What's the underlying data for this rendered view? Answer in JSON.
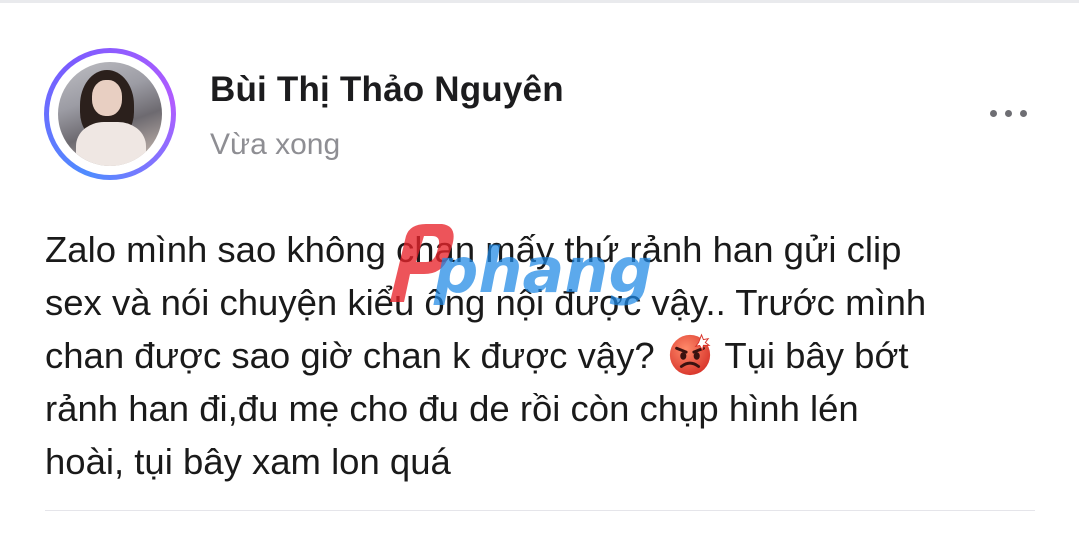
{
  "post": {
    "author_name": "Bùi Thị Thảo Nguyên",
    "timestamp": "Vừa xong",
    "text_lines": [
      "Zalo mình sao không chan mấy thứ rảnh han gửi clip",
      "sex và nói chuyện kiểu ông nội được vậy.. Trước mình",
      "chan được sao giờ chan k được vậy?",
      "Tụi bây bớt",
      "rảnh han đi,đu mẹ cho đu de rồi còn chụp hình lén",
      "hoài, tụi bây xam lon quá"
    ],
    "emoji": "angry-face",
    "more_icon": "more-horizontal-icon"
  },
  "watermark": {
    "text": "phang",
    "icon": "watermark-logo"
  },
  "colors": {
    "avatar_ring_start": "#4f8cff",
    "avatar_ring_end": "#b15cff",
    "name_text": "#1c1c1e",
    "timestamp_text": "#8e8e93",
    "body_text": "#1a1a1a",
    "emoji_fill": "#e8473a",
    "watermark_red": "#e8242b",
    "watermark_blue": "#1e88e5"
  }
}
